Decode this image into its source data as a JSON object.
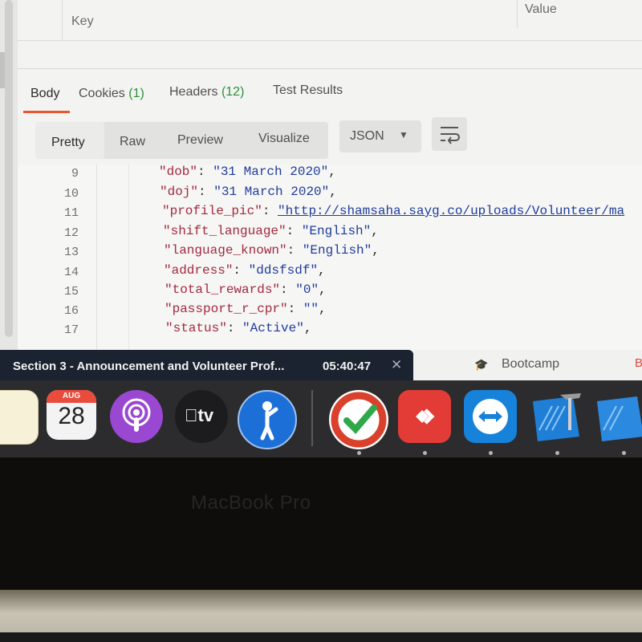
{
  "params_table": {
    "key_header": "Key",
    "value_header": "Value"
  },
  "response_tabs": [
    {
      "label": "Body",
      "count": ""
    },
    {
      "label": "Cookies",
      "count": "(1)"
    },
    {
      "label": "Headers",
      "count": "(12)"
    },
    {
      "label": "Test Results",
      "count": ""
    }
  ],
  "view_modes": [
    "Pretty",
    "Raw",
    "Preview",
    "Visualize"
  ],
  "format_select": {
    "value": "JSON"
  },
  "code_lines": [
    {
      "num": "9",
      "key": "\"dob\"",
      "sep": ": ",
      "value": "\"31 March 2020\"",
      "end": ","
    },
    {
      "num": "10",
      "key": "\"doj\"",
      "sep": ": ",
      "value": "\"31 March 2020\"",
      "end": ","
    },
    {
      "num": "11",
      "key": "\"profile_pic\"",
      "sep": ": ",
      "value": "\"http://shamsaha.sayg.co/uploads/Volunteer/ma",
      "end": ""
    },
    {
      "num": "12",
      "key": "\"shift_language\"",
      "sep": ": ",
      "value": "\"English\"",
      "end": ","
    },
    {
      "num": "13",
      "key": "\"language_known\"",
      "sep": ": ",
      "value": "\"English\"",
      "end": ","
    },
    {
      "num": "14",
      "key": "\"address\"",
      "sep": ": ",
      "value": "\"ddsfsdf\"",
      "end": ","
    },
    {
      "num": "15",
      "key": "\"total_rewards\"",
      "sep": ": ",
      "value": "\"0\"",
      "end": ","
    },
    {
      "num": "16",
      "key": "\"passport_r_cpr\"",
      "sep": ": ",
      "value": "\"\"",
      "end": ","
    },
    {
      "num": "17",
      "key": "\"status\"",
      "sep": ": ",
      "value": "\"Active\"",
      "end": ","
    }
  ],
  "video_overlay": {
    "title": "Section 3 - Announcement and Volunteer Prof...",
    "time": "05:40:47",
    "close": "✕"
  },
  "background_tab": {
    "label": "Bootcamp",
    "partial": "B"
  },
  "dock": {
    "calendar_month": "AUG",
    "calendar_day": "28",
    "tv_label": "tv"
  },
  "bezel_label": "MacBook Pro",
  "colors": {
    "active_tab_underline": "#e8572f",
    "json_key": "#a3293e",
    "json_string": "#1f3c9b",
    "count_green": "#2f8f3f"
  }
}
